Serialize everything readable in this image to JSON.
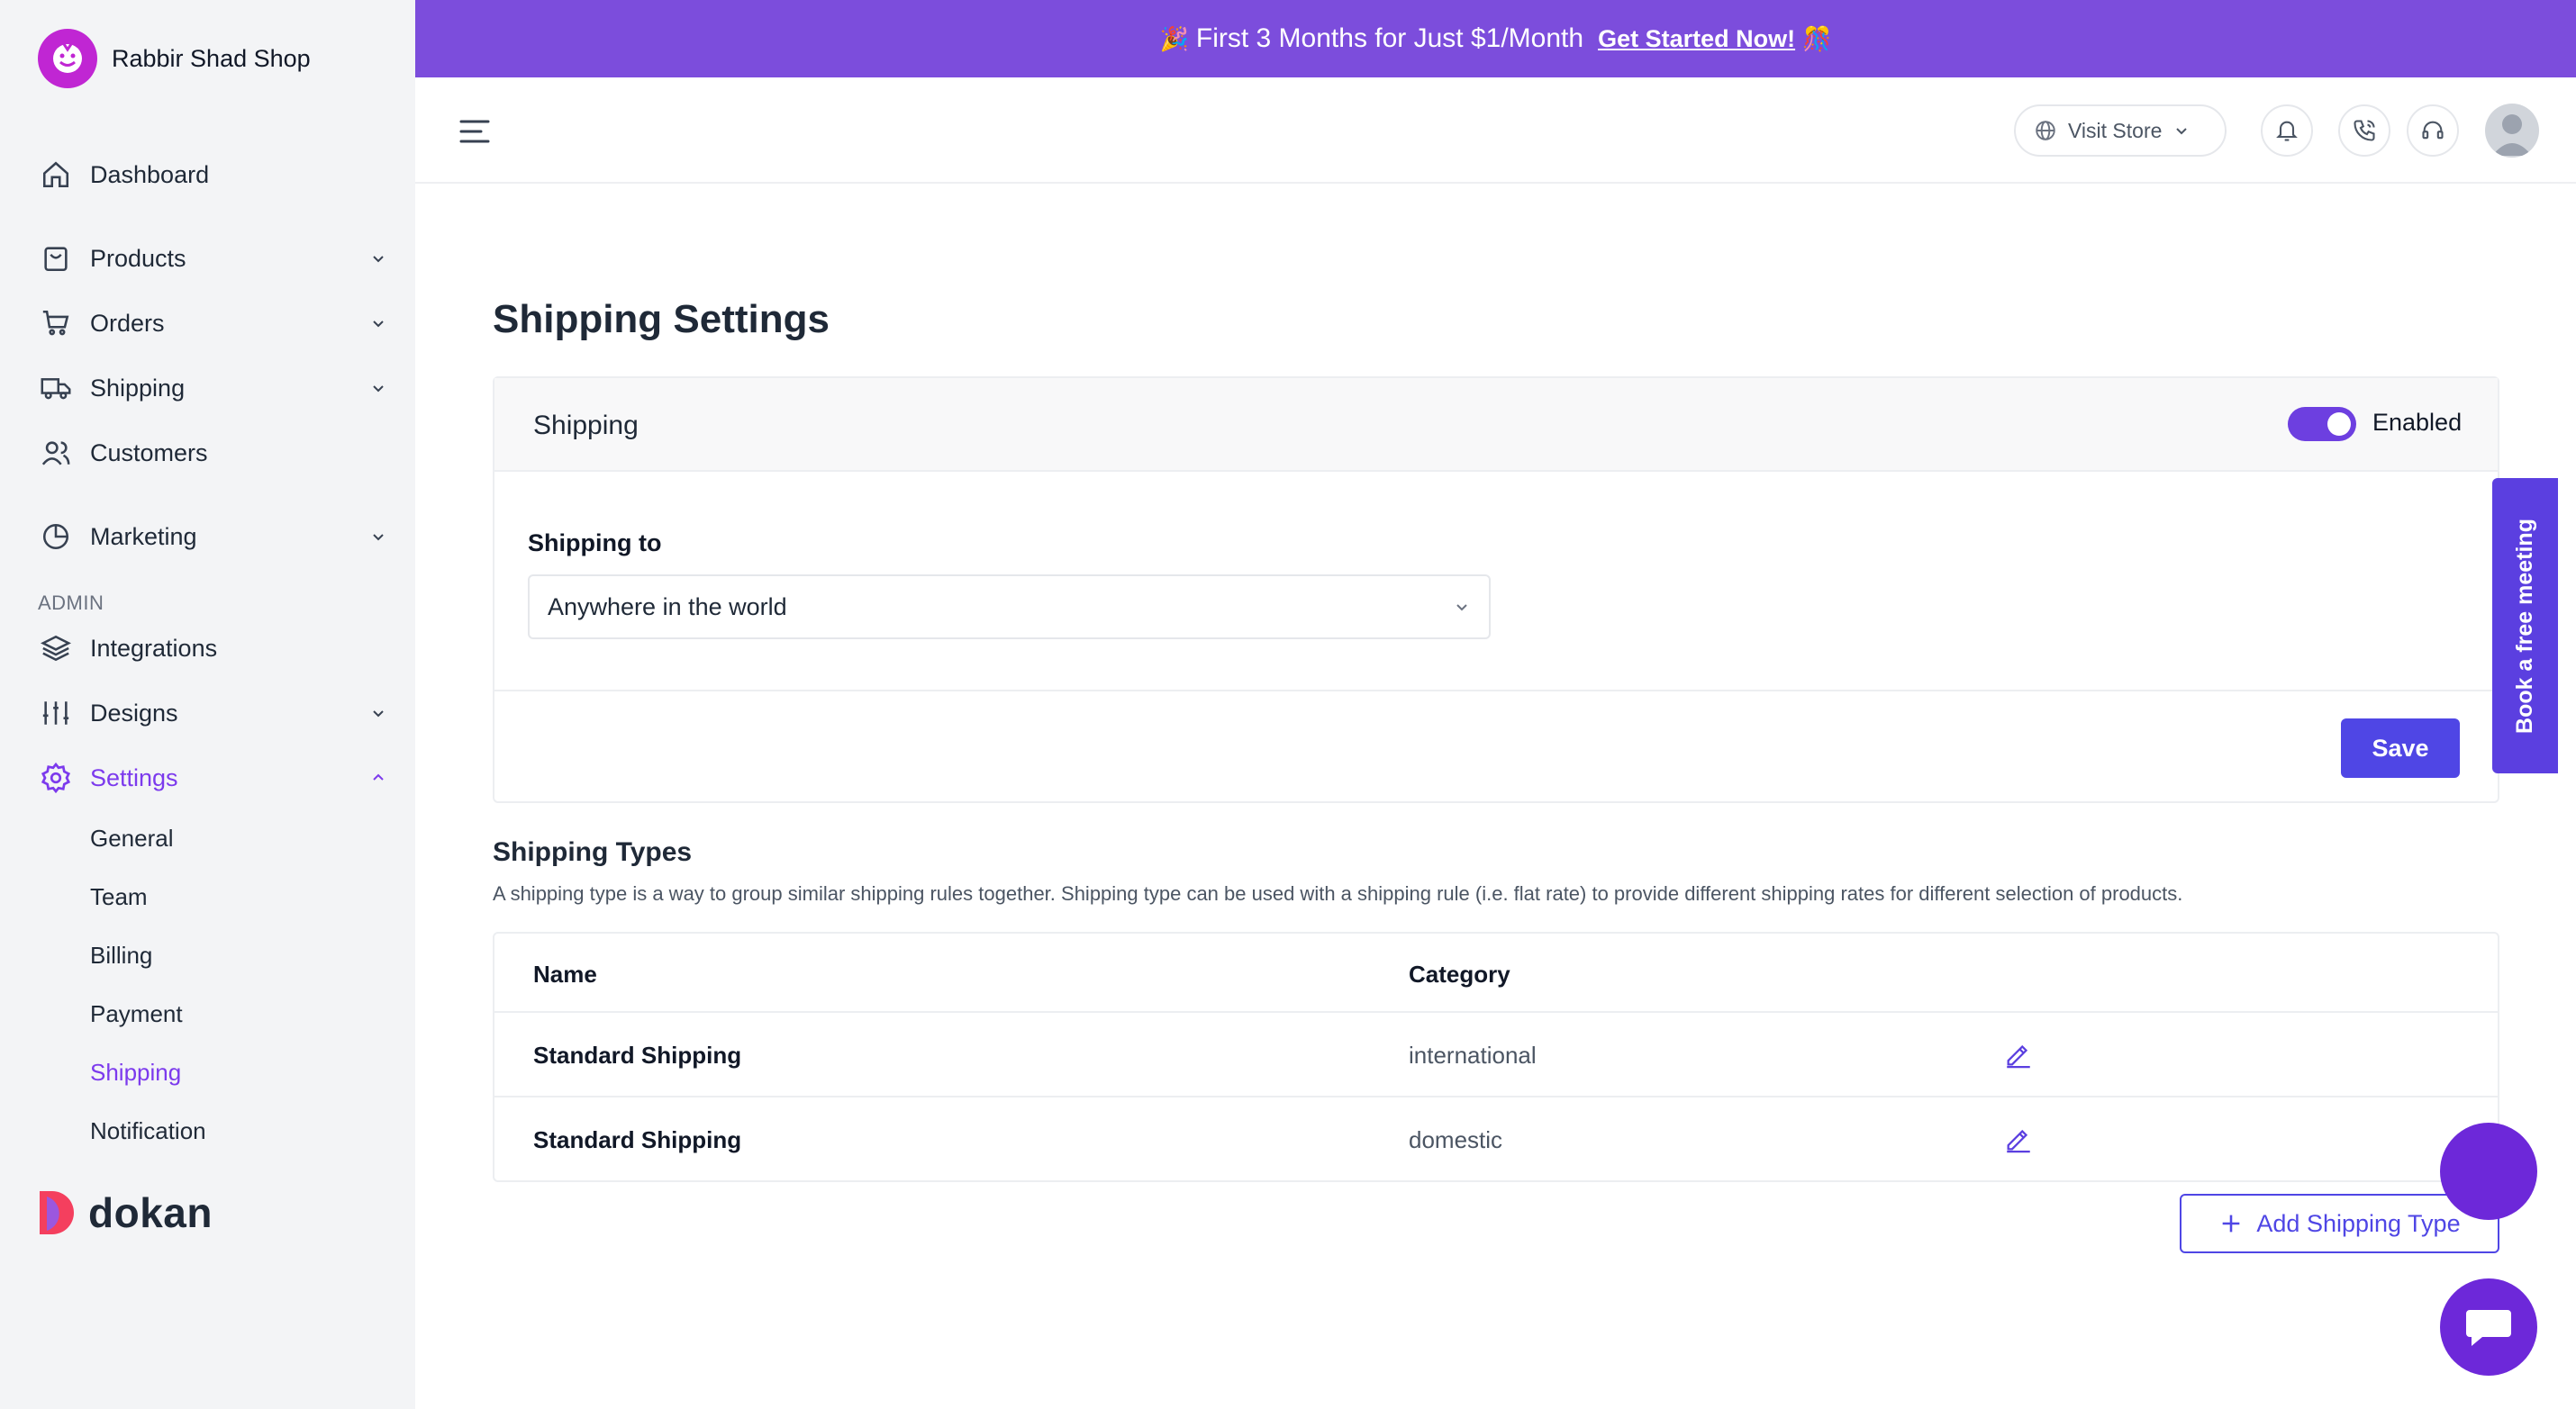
{
  "sidebar": {
    "shop_name": "Rabbir Shad Shop",
    "items": [
      {
        "label": "Dashboard",
        "icon": "home-icon"
      },
      {
        "label": "Products",
        "icon": "shopping-bag-icon"
      },
      {
        "label": "Orders",
        "icon": "cart-icon"
      },
      {
        "label": "Shipping",
        "icon": "truck-icon"
      },
      {
        "label": "Customers",
        "icon": "users-icon"
      },
      {
        "label": "Marketing",
        "icon": "pie-chart-icon"
      },
      {
        "label": "Integrations",
        "icon": "layers-icon"
      },
      {
        "label": "Designs",
        "icon": "sliders-icon"
      },
      {
        "label": "Settings",
        "icon": "gear-icon"
      }
    ],
    "admin_label": "ADMIN",
    "settings_sub": [
      "General",
      "Team",
      "Billing",
      "Payment",
      "Shipping",
      "Notification"
    ],
    "footer_brand": "dokan"
  },
  "promo": {
    "text": "First 3 Months for Just $1/Month",
    "cta": "Get Started Now!"
  },
  "header": {
    "visit_store": "Visit Store"
  },
  "page": {
    "title": "Shipping Settings",
    "shipping_card": {
      "title": "Shipping",
      "toggle_label": "Enabled",
      "toggle_on": true,
      "field_label": "Shipping to",
      "select_value": "Anywhere in the world",
      "save_label": "Save"
    },
    "types": {
      "title": "Shipping Types",
      "description": "A shipping type is a way to group similar shipping rules together. Shipping type can be used with a shipping rule (i.e. flat rate) to provide different shipping rates for different selection of products.",
      "columns": [
        "Name",
        "Category"
      ],
      "rows": [
        {
          "name": "Standard Shipping",
          "category": "international"
        },
        {
          "name": "Standard Shipping",
          "category": "domestic"
        }
      ],
      "add_label": "Add Shipping Type"
    }
  },
  "book_meeting": "Book a free meeting",
  "colors": {
    "accent": "#7c3aed",
    "primary_button": "#4f46e5",
    "banner": "#7c4ddc"
  }
}
